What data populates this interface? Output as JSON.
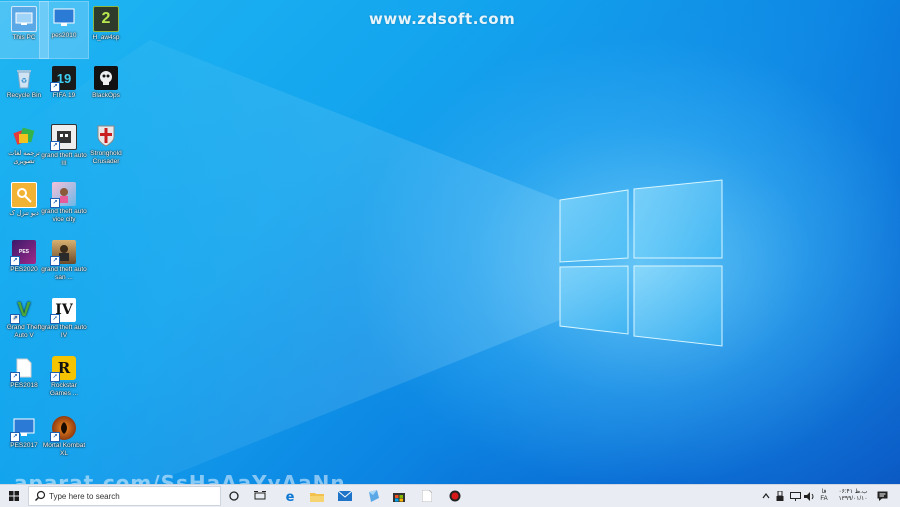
{
  "watermark": "www.zdsoft.com",
  "overlay_text": "aparat.com/SsHaAaYyAaNn",
  "desktop_icons": [
    {
      "label": "This PC",
      "icon": "computer-icon",
      "color": "#5aa9e6"
    },
    {
      "label": "pes2010",
      "icon": "pes-icon",
      "color": "#2b7bd6"
    },
    {
      "label": "H_aw4sp",
      "icon": "halo-icon",
      "color": "#2f3b2a"
    },
    {
      "label": "Recycle Bin",
      "icon": "recycle-bin-icon",
      "color": "#8fb8d8"
    },
    {
      "label": "FIFA 19",
      "icon": "fifa-icon",
      "color": "#1fa0d0"
    },
    {
      "label": "BlackOps",
      "icon": "black-ops-icon",
      "color": "#1b1b1b"
    },
    {
      "label": "ترجمه لغات تصویری",
      "icon": "dictionary-icon",
      "color": "#e23c3c"
    },
    {
      "label": "grand theft auto III",
      "icon": "gta3-icon",
      "color": "#333333"
    },
    {
      "label": "Stronghold Crusader",
      "icon": "stronghold-icon",
      "color": "#c8c8c8"
    },
    {
      "label": "دیو تنزل ک",
      "icon": "key-icon",
      "color": "#f2b233"
    },
    {
      "label": "grand theft auto vice city",
      "icon": "gta-vice-city-icon",
      "color": "#e07aa8"
    },
    {
      "label": "PES2020",
      "icon": "pes2020-icon",
      "color": "#7a2aa8"
    },
    {
      "label": "grand theft auto san ...",
      "icon": "gta-san-andreas-icon",
      "color": "#8a5a2a"
    },
    {
      "label": "Grand Theft Auto V",
      "icon": "gta5-icon",
      "color": "#4a8a3a"
    },
    {
      "label": "grand theft auto IV",
      "icon": "gta4-icon",
      "color": "#222222"
    },
    {
      "label": "PES2018",
      "icon": "file-icon",
      "color": "#ffffff"
    },
    {
      "label": "Rockstar Games ...",
      "icon": "rockstar-icon",
      "color": "#f5c400"
    },
    {
      "label": "PES2017",
      "icon": "pes2017-icon",
      "color": "#2b7bd6"
    },
    {
      "label": "Mortal Kombat XL",
      "icon": "mortal-kombat-icon",
      "color": "#c04010"
    }
  ],
  "taskbar": {
    "search_placeholder": "Type here to search",
    "pinned": [
      {
        "icon": "task-view-icon"
      },
      {
        "icon": "taskbar-settings-icon"
      },
      {
        "icon": "edge-icon"
      },
      {
        "icon": "file-explorer-icon"
      },
      {
        "icon": "mail-icon"
      },
      {
        "icon": "app-icon"
      },
      {
        "icon": "store-icon"
      },
      {
        "icon": "document-icon"
      },
      {
        "icon": "record-icon"
      }
    ],
    "tray": {
      "language": "FA",
      "language_top": "فا",
      "time": "۰۶:۴۱ ب.ظ",
      "date": "۱۳۹۹/۰۱/۱۰"
    }
  },
  "colors": {
    "taskbar_bg": "#e9edf3",
    "start_blue": "#1a1a1a",
    "edge_blue": "#0f78d4",
    "record_red": "#d81818"
  }
}
